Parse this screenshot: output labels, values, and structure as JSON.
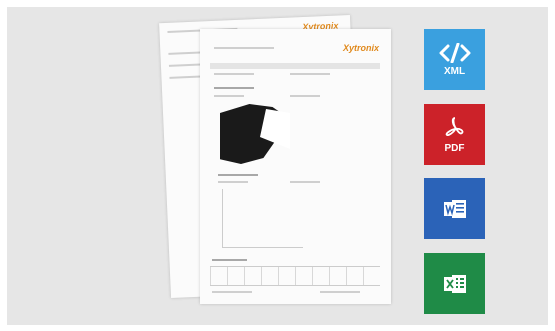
{
  "tiles": [
    {
      "label": "XML",
      "color": "#3aa0df",
      "icon": "code-icon"
    },
    {
      "label": "PDF",
      "color": "#cc2229",
      "icon": "pdf-icon"
    },
    {
      "label": "",
      "color": "#2b63b8",
      "icon": "word-icon"
    },
    {
      "label": "",
      "color": "#1f8b47",
      "icon": "excel-icon"
    }
  ]
}
